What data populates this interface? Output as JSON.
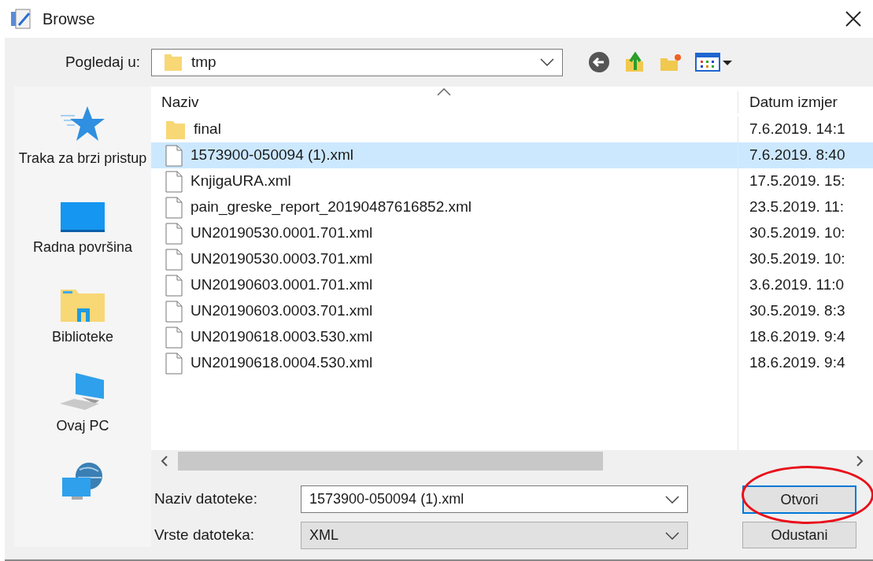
{
  "window": {
    "title": "Browse"
  },
  "look_in": {
    "label": "Pogledaj u:",
    "value": "tmp"
  },
  "sidebar": {
    "items": [
      {
        "kind": "quick-access",
        "label": "Traka za brzi pristup"
      },
      {
        "kind": "desktop",
        "label": "Radna površina"
      },
      {
        "kind": "libraries",
        "label": "Biblioteke"
      },
      {
        "kind": "pc",
        "label": "Ovaj PC"
      },
      {
        "kind": "network"
      }
    ]
  },
  "file_list": {
    "columns": [
      "Naziv",
      "Datum izmjer"
    ],
    "rows": [
      {
        "kind": "folder",
        "name": "final",
        "date": "7.6.2019. 14:1",
        "selected": false
      },
      {
        "kind": "file",
        "name": "1573900-050094 (1).xml",
        "date": "7.6.2019. 8:40",
        "selected": true
      },
      {
        "kind": "file",
        "name": "KnjigaURA.xml",
        "date": "17.5.2019. 15:",
        "selected": false
      },
      {
        "kind": "file",
        "name": "pain_greske_report_20190487616852.xml",
        "date": "23.5.2019. 11:",
        "selected": false
      },
      {
        "kind": "file",
        "name": "UN20190530.0001.701.xml",
        "date": "30.5.2019. 10:",
        "selected": false
      },
      {
        "kind": "file",
        "name": "UN20190530.0003.701.xml",
        "date": "30.5.2019. 10:",
        "selected": false
      },
      {
        "kind": "file",
        "name": "UN20190603.0001.701.xml",
        "date": "3.6.2019. 11:0",
        "selected": false
      },
      {
        "kind": "file",
        "name": "UN20190603.0003.701.xml",
        "date": "30.5.2019. 8:3",
        "selected": false
      },
      {
        "kind": "file",
        "name": "UN20190618.0003.530.xml",
        "date": "18.6.2019. 9:4",
        "selected": false
      },
      {
        "kind": "file",
        "name": "UN20190618.0004.530.xml",
        "date": "18.6.2019. 9:4",
        "selected": false
      }
    ]
  },
  "file_name": {
    "label": "Naziv datoteke:",
    "value": "1573900-050094 (1).xml"
  },
  "file_type": {
    "label": "Vrste datoteka:",
    "value": "XML"
  },
  "buttons": [
    {
      "label": "Otvori",
      "highlighted": true
    },
    {
      "label": "Odustani",
      "highlighted": false
    }
  ]
}
